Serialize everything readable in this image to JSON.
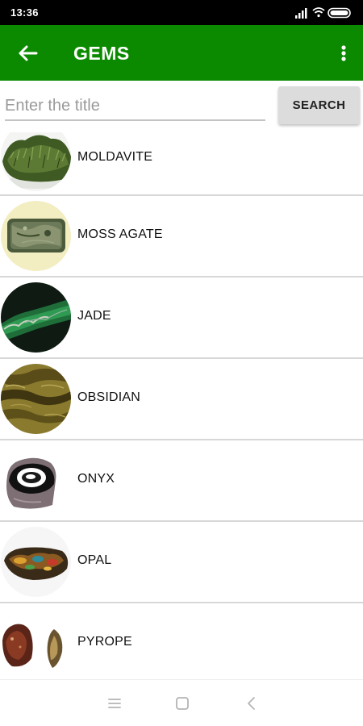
{
  "status_bar": {
    "time": "13:36",
    "icons": [
      "signal-icon",
      "wifi-icon",
      "battery-icon"
    ]
  },
  "app_bar": {
    "title": "GEMS",
    "color": "#0b8a00",
    "left_icon": "back-arrow-icon",
    "right_icon": "more-vert-icon"
  },
  "search": {
    "placeholder": "Enter the title",
    "value": "",
    "button_label": "SEARCH"
  },
  "gems": [
    {
      "name": "MOLDAVITE",
      "image": "moldavite-image"
    },
    {
      "name": "MOSS AGATE",
      "image": "moss-agate-image"
    },
    {
      "name": "JADE",
      "image": "jade-image"
    },
    {
      "name": "OBSIDIAN",
      "image": "obsidian-image"
    },
    {
      "name": "ONYX",
      "image": "onyx-image"
    },
    {
      "name": "OPAL",
      "image": "opal-image"
    },
    {
      "name": "PYROPE",
      "image": "pyrope-image"
    }
  ],
  "nav_bar": {
    "buttons": [
      "menu-icon",
      "home-square-icon",
      "back-chevron-icon"
    ]
  }
}
